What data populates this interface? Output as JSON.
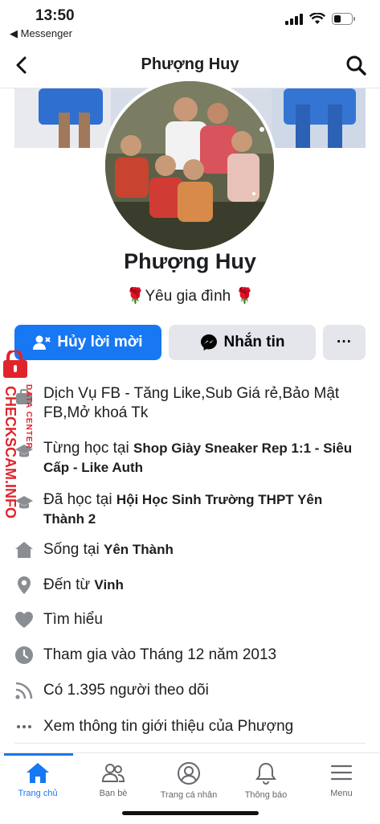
{
  "status_bar": {
    "time": "13:50",
    "back_app": "◀ Messenger"
  },
  "header": {
    "title": "Phượng Huy"
  },
  "profile": {
    "name": "Phượng Huy",
    "bio": "🌹Yêu gia đình 🌹"
  },
  "actions": {
    "primary_label": "Hủy lời mời",
    "message_label": "Nhắn tin",
    "more_label": "···"
  },
  "info": [
    {
      "icon": "briefcase-icon",
      "text": "Dịch Vụ FB - Tăng Like,Sub Giá rẻ,Bảo Mật FB,Mở khoá Tk",
      "prefix": "",
      "bold": ""
    },
    {
      "icon": "graduation-cap-icon",
      "text": "",
      "prefix": "Từng học tại ",
      "bold": "Shop Giày Sneaker Rep 1:1 - Siêu Cấp - Like Auth"
    },
    {
      "icon": "graduation-cap-icon",
      "text": "",
      "prefix": "Đã học tại ",
      "bold": "Hội Học Sinh Trường THPT Yên Thành 2"
    },
    {
      "icon": "home-icon",
      "text": "",
      "prefix": "Sống tại ",
      "bold": "Yên Thành"
    },
    {
      "icon": "location-pin-icon",
      "text": "",
      "prefix": "Đến từ ",
      "bold": "Vinh"
    },
    {
      "icon": "heart-icon",
      "text": "Tìm hiểu",
      "prefix": "",
      "bold": ""
    },
    {
      "icon": "clock-icon",
      "text": "Tham gia vào Tháng 12 năm 2013",
      "prefix": "",
      "bold": ""
    },
    {
      "icon": "rss-icon",
      "text": "Có 1.395 người theo dõi",
      "prefix": "",
      "bold": ""
    },
    {
      "icon": "more-dots-icon",
      "text": "Xem thông tin giới thiệu của Phượng",
      "prefix": "",
      "bold": ""
    }
  ],
  "watermark": {
    "line1": "DATA CENTER",
    "line2": "CHECKSCAM.INFO"
  },
  "tabs": [
    {
      "label": "Trang chủ",
      "icon": "home-icon",
      "active": true
    },
    {
      "label": "Bạn bè",
      "icon": "friends-icon",
      "active": false
    },
    {
      "label": "Trang cá nhân",
      "icon": "profile-icon",
      "active": false
    },
    {
      "label": "Thông báo",
      "icon": "bell-icon",
      "active": false
    },
    {
      "label": "Menu",
      "icon": "menu-icon",
      "active": false
    }
  ],
  "colors": {
    "accent": "#1877f2",
    "secondary_button": "#e4e6eb",
    "icon_gray": "#65676b",
    "watermark_red": "#e0242b"
  }
}
